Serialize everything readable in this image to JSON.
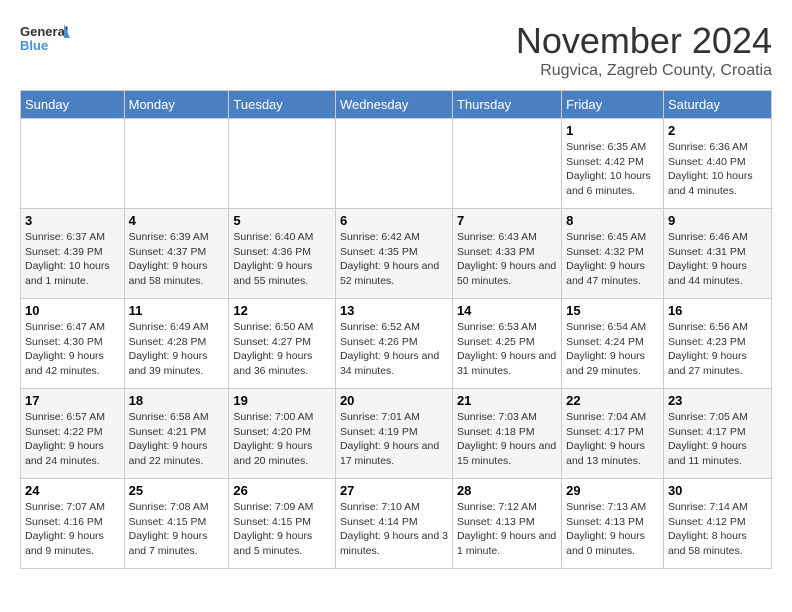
{
  "header": {
    "logo_general": "General",
    "logo_blue": "Blue",
    "month": "November 2024",
    "location": "Rugvica, Zagreb County, Croatia"
  },
  "weekdays": [
    "Sunday",
    "Monday",
    "Tuesday",
    "Wednesday",
    "Thursday",
    "Friday",
    "Saturday"
  ],
  "weeks": [
    [
      {
        "day": "",
        "info": ""
      },
      {
        "day": "",
        "info": ""
      },
      {
        "day": "",
        "info": ""
      },
      {
        "day": "",
        "info": ""
      },
      {
        "day": "",
        "info": ""
      },
      {
        "day": "1",
        "info": "Sunrise: 6:35 AM\nSunset: 4:42 PM\nDaylight: 10 hours and 6 minutes."
      },
      {
        "day": "2",
        "info": "Sunrise: 6:36 AM\nSunset: 4:40 PM\nDaylight: 10 hours and 4 minutes."
      }
    ],
    [
      {
        "day": "3",
        "info": "Sunrise: 6:37 AM\nSunset: 4:39 PM\nDaylight: 10 hours and 1 minute."
      },
      {
        "day": "4",
        "info": "Sunrise: 6:39 AM\nSunset: 4:37 PM\nDaylight: 9 hours and 58 minutes."
      },
      {
        "day": "5",
        "info": "Sunrise: 6:40 AM\nSunset: 4:36 PM\nDaylight: 9 hours and 55 minutes."
      },
      {
        "day": "6",
        "info": "Sunrise: 6:42 AM\nSunset: 4:35 PM\nDaylight: 9 hours and 52 minutes."
      },
      {
        "day": "7",
        "info": "Sunrise: 6:43 AM\nSunset: 4:33 PM\nDaylight: 9 hours and 50 minutes."
      },
      {
        "day": "8",
        "info": "Sunrise: 6:45 AM\nSunset: 4:32 PM\nDaylight: 9 hours and 47 minutes."
      },
      {
        "day": "9",
        "info": "Sunrise: 6:46 AM\nSunset: 4:31 PM\nDaylight: 9 hours and 44 minutes."
      }
    ],
    [
      {
        "day": "10",
        "info": "Sunrise: 6:47 AM\nSunset: 4:30 PM\nDaylight: 9 hours and 42 minutes."
      },
      {
        "day": "11",
        "info": "Sunrise: 6:49 AM\nSunset: 4:28 PM\nDaylight: 9 hours and 39 minutes."
      },
      {
        "day": "12",
        "info": "Sunrise: 6:50 AM\nSunset: 4:27 PM\nDaylight: 9 hours and 36 minutes."
      },
      {
        "day": "13",
        "info": "Sunrise: 6:52 AM\nSunset: 4:26 PM\nDaylight: 9 hours and 34 minutes."
      },
      {
        "day": "14",
        "info": "Sunrise: 6:53 AM\nSunset: 4:25 PM\nDaylight: 9 hours and 31 minutes."
      },
      {
        "day": "15",
        "info": "Sunrise: 6:54 AM\nSunset: 4:24 PM\nDaylight: 9 hours and 29 minutes."
      },
      {
        "day": "16",
        "info": "Sunrise: 6:56 AM\nSunset: 4:23 PM\nDaylight: 9 hours and 27 minutes."
      }
    ],
    [
      {
        "day": "17",
        "info": "Sunrise: 6:57 AM\nSunset: 4:22 PM\nDaylight: 9 hours and 24 minutes."
      },
      {
        "day": "18",
        "info": "Sunrise: 6:58 AM\nSunset: 4:21 PM\nDaylight: 9 hours and 22 minutes."
      },
      {
        "day": "19",
        "info": "Sunrise: 7:00 AM\nSunset: 4:20 PM\nDaylight: 9 hours and 20 minutes."
      },
      {
        "day": "20",
        "info": "Sunrise: 7:01 AM\nSunset: 4:19 PM\nDaylight: 9 hours and 17 minutes."
      },
      {
        "day": "21",
        "info": "Sunrise: 7:03 AM\nSunset: 4:18 PM\nDaylight: 9 hours and 15 minutes."
      },
      {
        "day": "22",
        "info": "Sunrise: 7:04 AM\nSunset: 4:17 PM\nDaylight: 9 hours and 13 minutes."
      },
      {
        "day": "23",
        "info": "Sunrise: 7:05 AM\nSunset: 4:17 PM\nDaylight: 9 hours and 11 minutes."
      }
    ],
    [
      {
        "day": "24",
        "info": "Sunrise: 7:07 AM\nSunset: 4:16 PM\nDaylight: 9 hours and 9 minutes."
      },
      {
        "day": "25",
        "info": "Sunrise: 7:08 AM\nSunset: 4:15 PM\nDaylight: 9 hours and 7 minutes."
      },
      {
        "day": "26",
        "info": "Sunrise: 7:09 AM\nSunset: 4:15 PM\nDaylight: 9 hours and 5 minutes."
      },
      {
        "day": "27",
        "info": "Sunrise: 7:10 AM\nSunset: 4:14 PM\nDaylight: 9 hours and 3 minutes."
      },
      {
        "day": "28",
        "info": "Sunrise: 7:12 AM\nSunset: 4:13 PM\nDaylight: 9 hours and 1 minute."
      },
      {
        "day": "29",
        "info": "Sunrise: 7:13 AM\nSunset: 4:13 PM\nDaylight: 9 hours and 0 minutes."
      },
      {
        "day": "30",
        "info": "Sunrise: 7:14 AM\nSunset: 4:12 PM\nDaylight: 8 hours and 58 minutes."
      }
    ]
  ]
}
